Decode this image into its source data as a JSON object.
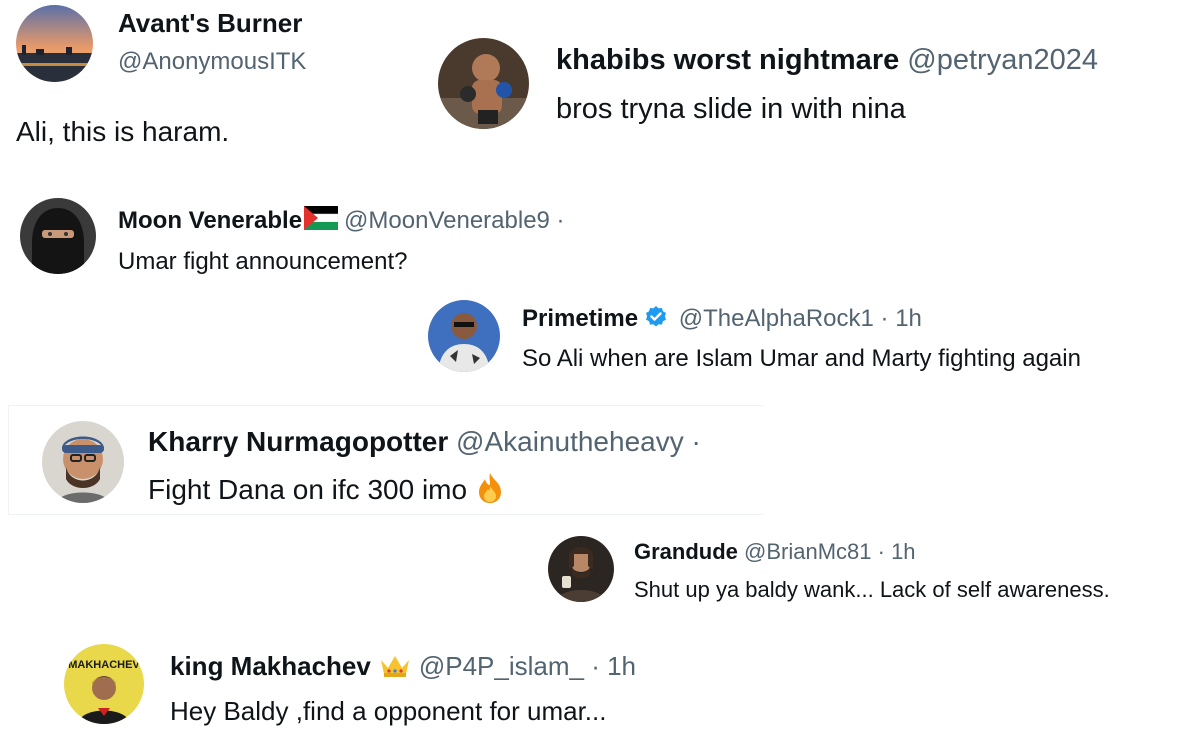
{
  "tweets": [
    {
      "name": "Avant's Burner",
      "handle": "@AnonymousITK",
      "text": "Ali, this is haram.",
      "avatar_icon": "sunset-avatar-icon"
    },
    {
      "name": "khabibs worst nightmare",
      "handle": "@petryan2024",
      "text": "bros tryna slide in with nina",
      "avatar_icon": "fighter-avatar-icon"
    },
    {
      "name": "Moon Venerable",
      "name_flag": "palestine-flag-icon",
      "handle": "@MoonVenerable9 ·",
      "text": "Umar fight announcement?",
      "avatar_icon": "niqab-avatar-icon"
    },
    {
      "name": "Primetime",
      "verified": true,
      "handle": "@TheAlphaRock1 · 1h",
      "text": "So Ali when are Islam Umar and Marty fighting again",
      "avatar_icon": "rock-avatar-icon"
    },
    {
      "name": "Kharry Nurmagopotter",
      "handle": "@Akainutheheavy ·",
      "text": "Fight Dana on ifc 300 imo",
      "text_emoji": "fire-icon",
      "avatar_icon": "bearded-man-avatar-icon"
    },
    {
      "name": "Grandude",
      "handle": "@BrianMc81 · 1h",
      "text": "Shut up ya baldy wank... Lack of self awareness.",
      "avatar_icon": "man-with-drink-avatar-icon"
    },
    {
      "name": "king Makhachev",
      "name_emoji": "crown-icon",
      "handle": "@P4P_islam_ · 1h",
      "text": "Hey Baldy ,find a opponent for umar...",
      "avatar_icon": "makhachev-avatar-icon",
      "avatar_logo_text": "MAKHACHEV"
    }
  ],
  "colors": {
    "text": "#0f1419",
    "secondary": "#536471",
    "verified": "#1d9bf0"
  }
}
